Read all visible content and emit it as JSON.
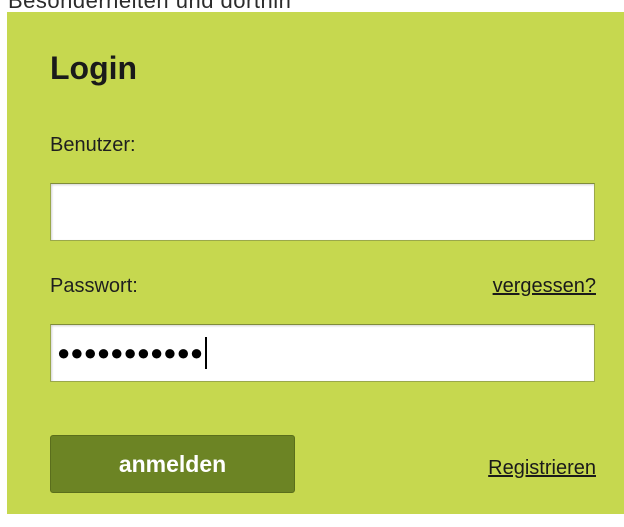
{
  "header_fragment": "Besonderheiten und dorthin",
  "login": {
    "title": "Login",
    "username_label": "Benutzer:",
    "username_value": "",
    "password_label": "Passwort:",
    "password_masked": "●●●●●●●●●●●",
    "forgot_link": "vergessen?",
    "submit_label": "anmelden",
    "register_link": "Registrieren"
  },
  "colors": {
    "panel_background": "#c6d84f",
    "button_background": "#6c8424",
    "button_text": "#ffffff"
  }
}
